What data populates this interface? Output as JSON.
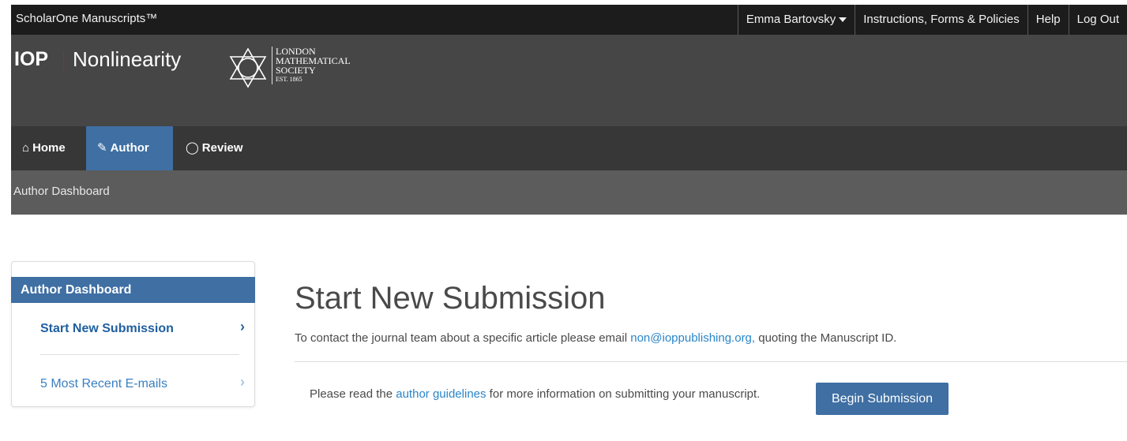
{
  "topbar": {
    "brand": "ScholarOne Manuscripts™",
    "user": "Emma Bartovsky",
    "links": [
      "Instructions, Forms & Policies",
      "Help",
      "Log Out"
    ]
  },
  "header": {
    "publisher": "IOP",
    "journal": "Nonlinearity",
    "society_lines": [
      "LONDON",
      "MATHEMATICAL",
      "SOCIETY"
    ],
    "society_est": "EST. 1865"
  },
  "nav": {
    "home": "Home",
    "author": "Author",
    "review": "Review",
    "active": "author"
  },
  "breadcrumb": "Author Dashboard",
  "sidebar": {
    "heading": "Author Dashboard",
    "items": [
      {
        "label": "Start New Submission"
      },
      {
        "label": "5 Most Recent E-mails"
      }
    ]
  },
  "main": {
    "title": "Start New Submission",
    "intro_before": "To contact the journal team about a specific article please email ",
    "intro_email": "non@ioppublishing.org,",
    "intro_after": " quoting the Manuscript ID.",
    "guide_before": "Please read the ",
    "guide_link": "author guidelines",
    "guide_after": " for more information on submitting your manuscript.",
    "begin_button": "Begin Submission"
  },
  "colors": {
    "accent": "#3f6fa3",
    "link": "#2a86c8",
    "topbar": "#1c1c1c",
    "header": "#464646",
    "nav": "#373737",
    "breadcrumb": "#5c5c5c"
  }
}
